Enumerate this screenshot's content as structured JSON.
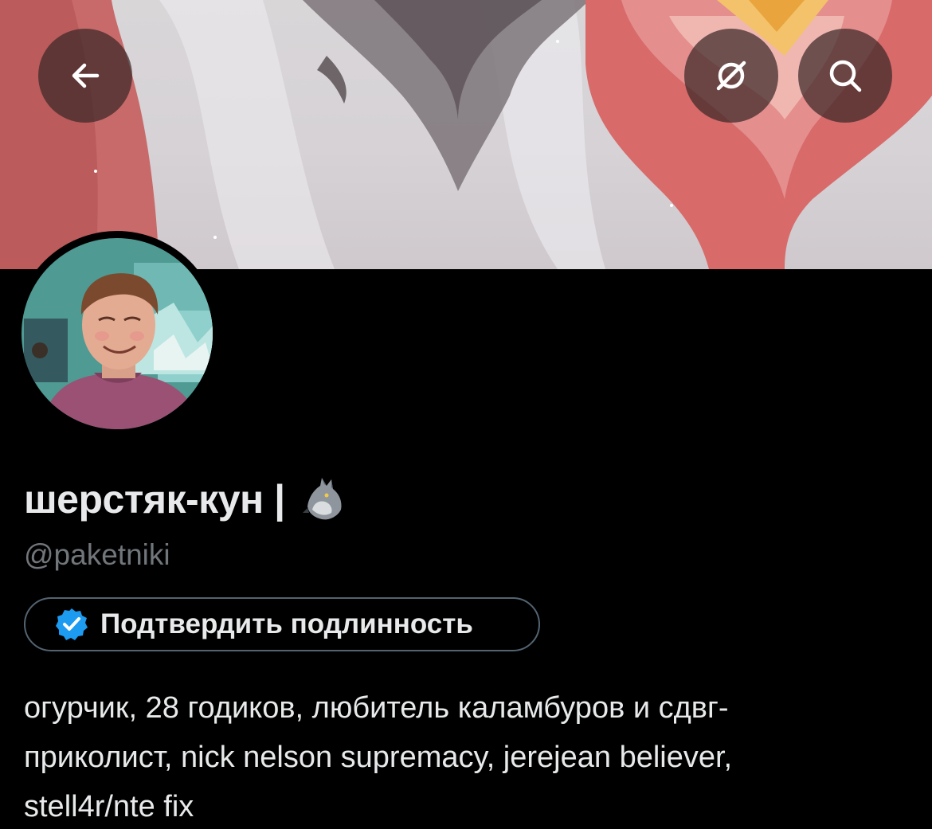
{
  "header": {
    "back_icon": "arrow-left-icon",
    "filter_icon": "slashed-circle-icon",
    "search_icon": "search-icon"
  },
  "profile": {
    "display_name": "шерстяк-кун | ",
    "name_emoji": "wolf-emoji",
    "handle": "@paketniki",
    "verify_button_label": "Подтвердить подлинность",
    "verify_icon": "verified-badge-icon",
    "bio_lines": [
      "огурчик, 28 годиков, любитель каламбуров и сдвг-",
      "приколист, nick nelson supremacy, jerejean believer,",
      "stell4r/nte fix"
    ]
  },
  "colors": {
    "background": "#000000",
    "text_primary": "#e7e9ea",
    "text_secondary": "#71767b",
    "verified_blue": "#1d9bf0",
    "button_border": "#536471"
  }
}
